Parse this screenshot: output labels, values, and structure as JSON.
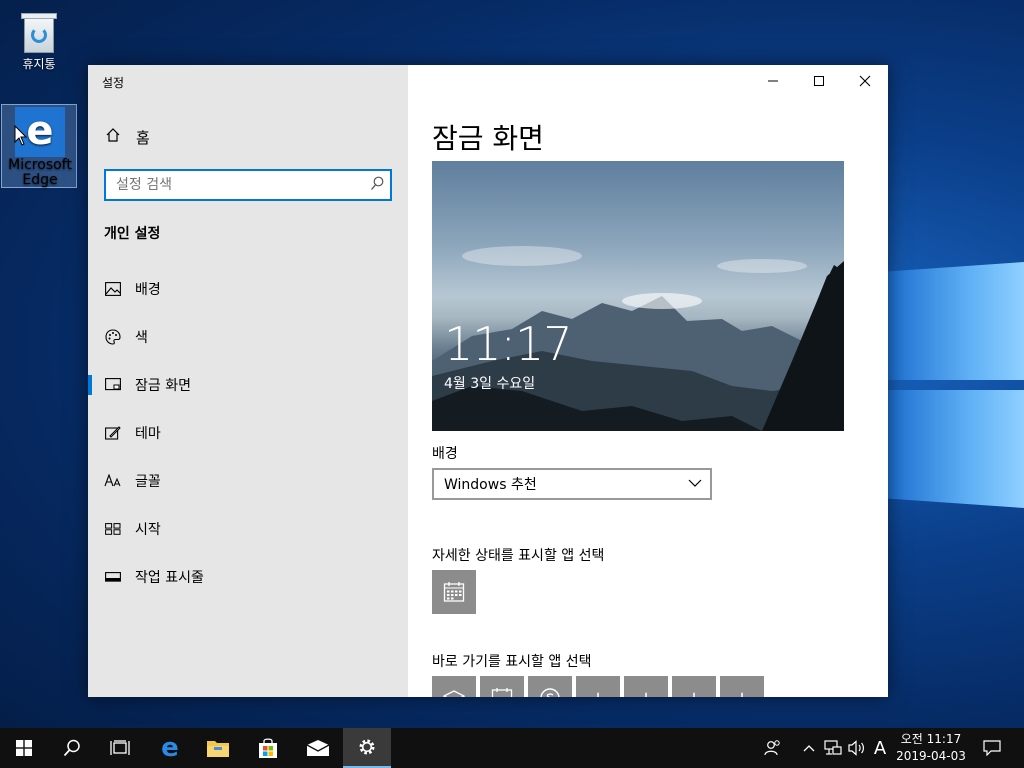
{
  "desktop": {
    "recycle_bin_label": "휴지통",
    "edge_label": "Microsoft Edge"
  },
  "window": {
    "app_title": "설정",
    "minimize_icon": "minimize-icon",
    "maximize_icon": "maximize-icon",
    "close_icon": "close-icon"
  },
  "sidebar": {
    "home_label": "홈",
    "search_placeholder": "설정 검색",
    "section_title": "개인 설정",
    "items": [
      {
        "label": "배경",
        "icon": "picture-icon"
      },
      {
        "label": "색",
        "icon": "palette-icon"
      },
      {
        "label": "잠금 화면",
        "icon": "lock-screen-icon",
        "active": true
      },
      {
        "label": "테마",
        "icon": "theme-brush-icon"
      },
      {
        "label": "글꼴",
        "icon": "font-icon"
      },
      {
        "label": "시작",
        "icon": "start-tiles-icon"
      },
      {
        "label": "작업 표시줄",
        "icon": "taskbar-icon"
      }
    ]
  },
  "main": {
    "page_title": "잠금 화면",
    "preview_time": "11:17",
    "preview_date": "4월 3일 수요일",
    "background_label": "배경",
    "background_value": "Windows 추천",
    "detailed_status_label": "자세한 상태를 표시할 앱 선택",
    "quick_status_label": "바로 가기를 표시할 앱 선택"
  },
  "taskbar": {
    "ime": "A",
    "clock_period_time": "오전 11:17",
    "clock_date": "2019-04-03"
  },
  "colors": {
    "accent": "#0078d7",
    "sidebar_bg": "#e6e6e6",
    "taskbar_bg": "#101010",
    "app_tile_gray": "#8c8c8c"
  }
}
